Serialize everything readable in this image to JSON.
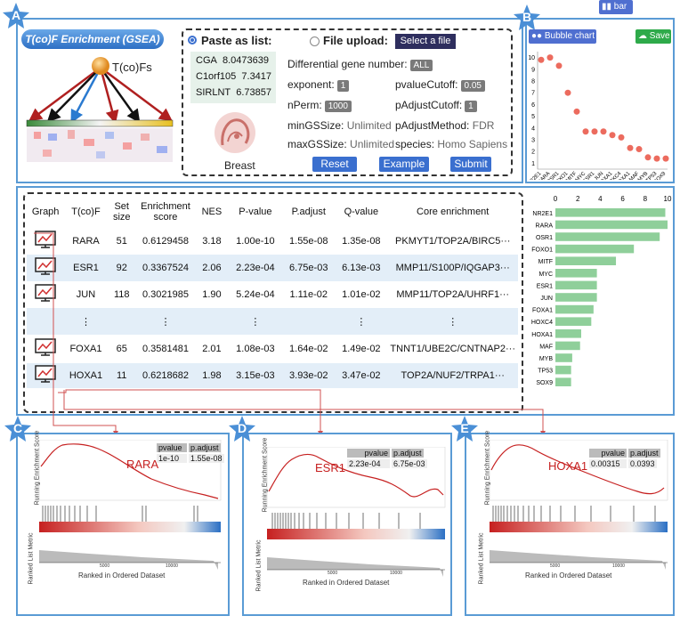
{
  "panel_a": {
    "title": "T(co)F Enrichment (GSEA)",
    "network_label": "T(co)Fs",
    "paste_label": "Paste as list:",
    "file_label": "File upload:",
    "select_file": "Select a file",
    "pasted_genes": [
      {
        "gene": "CGA",
        "value": "8.0473639"
      },
      {
        "gene": "C1orf105",
        "value": "7.3417"
      },
      {
        "gene": "SIRLNT",
        "value": "6.73857"
      }
    ],
    "tissue_label": "Breast",
    "params": {
      "diff_label": "Differential gene number:",
      "diff_value": "ALL",
      "exponent_label": "exponent:",
      "exponent_value": "1",
      "pvalue_label": "pvalueCutoff:",
      "pvalue_value": "0.05",
      "nperm_label": "nPerm:",
      "nperm_value": "1000",
      "padjust_label": "pAdjustCutoff:",
      "padjust_value": "1",
      "min_label": "minGSSize:",
      "min_value": "Unlimited",
      "method_label": "pAdjustMethod:",
      "method_value": "FDR",
      "max_label": "maxGSSize:",
      "max_value": "Unlimited",
      "species_label": "species:",
      "species_value": "Homo Sapiens"
    },
    "buttons": {
      "reset": "Reset",
      "example": "Example",
      "submit": "Submit"
    }
  },
  "panel_b": {
    "buttons": {
      "bubble": "Bubble chart",
      "bar": "bar",
      "save": "Save"
    }
  },
  "stars": {
    "a": "A",
    "b": "B",
    "c": "C",
    "d": "D",
    "e": "E"
  },
  "table": {
    "headers": [
      "Graph",
      "T(co)F",
      "Set size",
      "Enrichment score",
      "NES",
      "P-value",
      "P.adjust",
      "Q-value",
      "Core enrichment"
    ],
    "rows": [
      {
        "tf": "RARA",
        "size": "51",
        "es": "0.6129458",
        "nes": "3.18",
        "p": "1.00e-10",
        "padj": "1.55e-08",
        "q": "1.35e-08",
        "core": "PKMYT1/TOP2A/BIRC5···"
      },
      {
        "tf": "ESR1",
        "size": "92",
        "es": "0.3367524",
        "nes": "2.06",
        "p": "2.23e-04",
        "padj": "6.75e-03",
        "q": "6.13e-03",
        "core": "MMP11/S100P/IQGAP3···"
      },
      {
        "tf": "JUN",
        "size": "118",
        "es": "0.3021985",
        "nes": "1.90",
        "p": "5.24e-04",
        "padj": "1.11e-02",
        "q": "1.01e-02",
        "core": "MMP11/TOP2A/UHRF1···"
      },
      {
        "tf": "⋮",
        "size": "",
        "es": "⋮",
        "nes": "",
        "p": "⋮",
        "padj": "",
        "q": "⋮",
        "core": "⋮"
      },
      {
        "tf": "FOXA1",
        "size": "65",
        "es": "0.3581481",
        "nes": "2.01",
        "p": "1.08e-03",
        "padj": "1.64e-02",
        "q": "1.49e-02",
        "core": "TNNT1/UBE2C/CNTNAP2···"
      },
      {
        "tf": "HOXA1",
        "size": "11",
        "es": "0.6218682",
        "nes": "1.98",
        "p": "3.15e-03",
        "padj": "3.93e-02",
        "q": "3.47e-02",
        "core": "TOP2A/NUF2/TRPA1···"
      }
    ]
  },
  "gsea_plots": [
    {
      "tf": "RARA",
      "pvalue": "1e-10",
      "padjust": "1.55e-08"
    },
    {
      "tf": "ESR1",
      "pvalue": "2.23e-04",
      "padjust": "6.75e-03"
    },
    {
      "tf": "HOXA1",
      "pvalue": "0.00315",
      "padjust": "0.0393"
    }
  ],
  "gsea_labels": {
    "pvalue": "pvalue",
    "padjust": "p.adjust",
    "y_top": "Running Enrichment Score",
    "y_bottom": "Ranked List Metric",
    "x": "Ranked in Ordered Dataset",
    "ticks": [
      "5000",
      "10000"
    ]
  },
  "chart_data": [
    {
      "type": "scatter",
      "categories": [
        "NR2E1",
        "RARA",
        "OSR1",
        "FOXO1",
        "MITF",
        "MYC",
        "ESR1",
        "JUN",
        "FOXA1",
        "HOXC4",
        "HOXA1",
        "MAF",
        "MYB",
        "TP53",
        "SOX9"
      ],
      "values": [
        9.8,
        10.0,
        9.3,
        7.0,
        5.4,
        3.7,
        3.7,
        3.7,
        3.4,
        3.2,
        2.3,
        2.2,
        1.5,
        1.4,
        1.4
      ],
      "ylim": [
        0.5,
        10.5
      ],
      "yticks": [
        "1",
        "2",
        "3",
        "4",
        "5",
        "6",
        "7",
        "8",
        "9",
        "10"
      ],
      "color": "#ec6b5e"
    },
    {
      "type": "bar",
      "orientation": "horizontal",
      "categories": [
        "NR2E1",
        "RARA",
        "OSR1",
        "FOXO1",
        "MITF",
        "MYC",
        "ESR1",
        "JUN",
        "FOXA1",
        "HOXC4",
        "HOXA1",
        "MAF",
        "MYB",
        "TP53",
        "SOX9"
      ],
      "values": [
        9.8,
        10.0,
        9.3,
        7.0,
        5.4,
        3.7,
        3.7,
        3.7,
        3.4,
        3.2,
        2.3,
        2.2,
        1.5,
        1.4,
        1.4
      ],
      "xlim": [
        0,
        10
      ],
      "xticks": [
        "0",
        "2",
        "4",
        "6",
        "8",
        "10"
      ],
      "color": "#8fcf9a"
    }
  ]
}
